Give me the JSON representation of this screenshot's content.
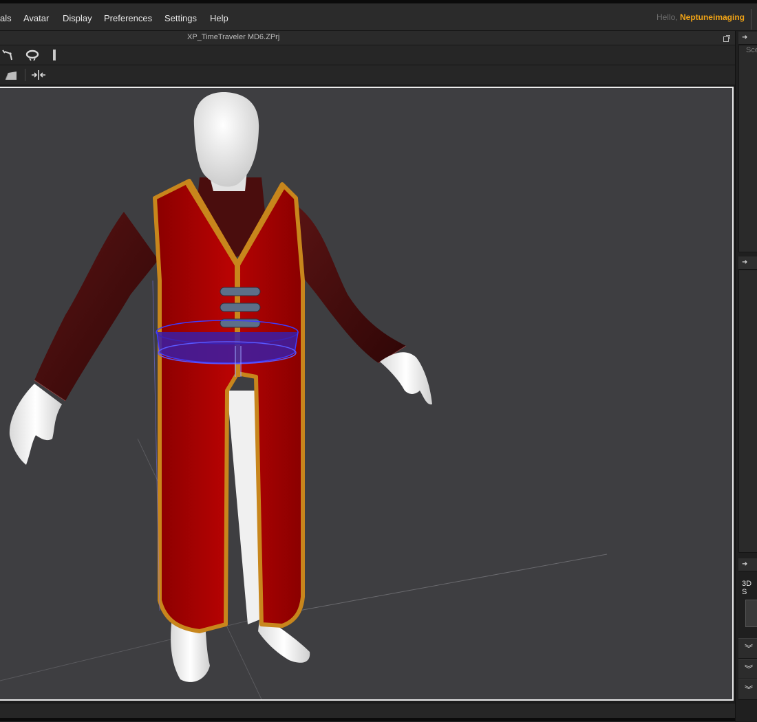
{
  "menu": {
    "items": [
      "als",
      "Avatar",
      "Display",
      "Preferences",
      "Settings",
      "Help"
    ],
    "greeting_prefix": "Hello,",
    "username": "Neptuneimaging"
  },
  "document": {
    "title": "XP_TimeTraveler MD6.ZPrj"
  },
  "right_panel": {
    "tab_label": "Sce",
    "section_label": "3D S"
  },
  "colors": {
    "accent": "#f0a316",
    "viewport_bg": "#3e3e41",
    "garment_red": "#a10000",
    "garment_trim": "#c8861c",
    "sleeve": "#4b0e0e",
    "belt": "#3a1ea8"
  },
  "icons": {
    "toolbar1": [
      "move-tool-icon",
      "lasso-tool-icon",
      "ring-tool-icon",
      "bar-tool-icon"
    ],
    "toolbar2": [
      "plane-tool-icon",
      "pinch-tool-icon"
    ]
  }
}
